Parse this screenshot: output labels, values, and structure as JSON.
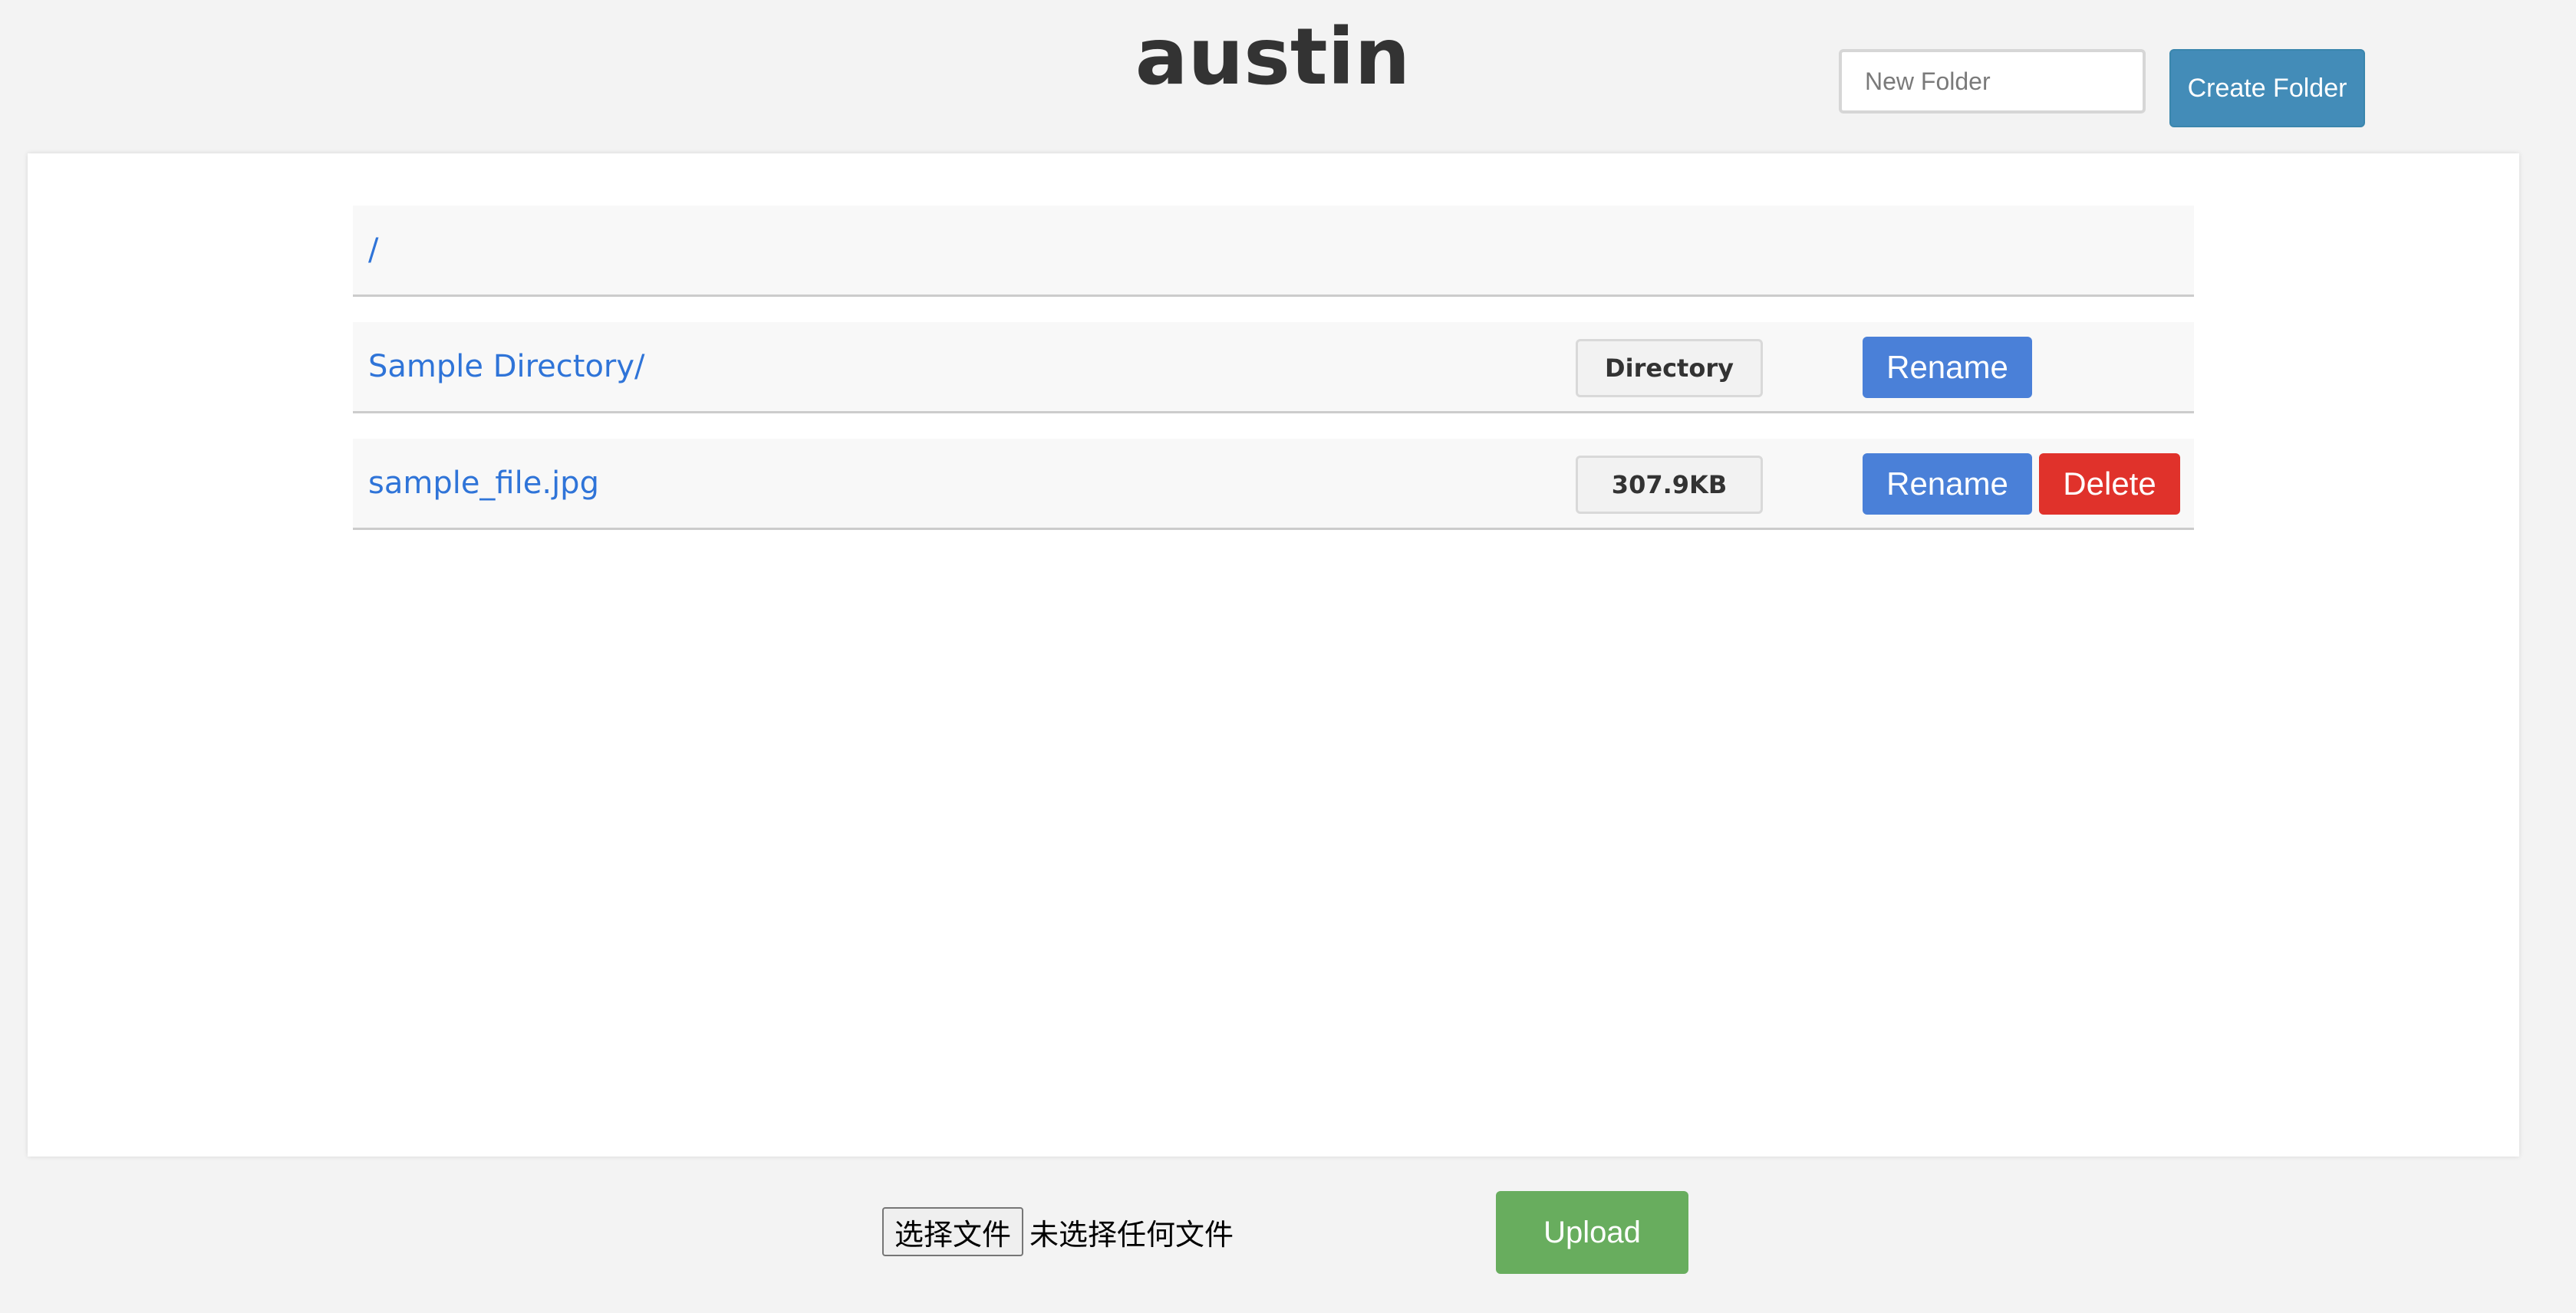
{
  "header": {
    "title": "austin",
    "new_folder_placeholder": "New Folder",
    "create_folder_label": "Create Folder"
  },
  "breadcrumb": {
    "path": "/"
  },
  "entries": [
    {
      "name": "Sample Directory/",
      "meta": "Directory",
      "rename_label": "Rename"
    },
    {
      "name": "sample_file.jpg",
      "meta": "307.9KB",
      "rename_label": "Rename",
      "delete_label": "Delete"
    }
  ],
  "upload": {
    "choose_file_label": "选择文件",
    "no_file_text": "未选择任何文件",
    "upload_label": "Upload"
  },
  "colors": {
    "background": "#f3f3f3",
    "link": "#2f74d8",
    "create_folder": "#438cb8",
    "rename": "#4a80d8",
    "delete": "#e0322b",
    "upload": "#68ad5e"
  }
}
